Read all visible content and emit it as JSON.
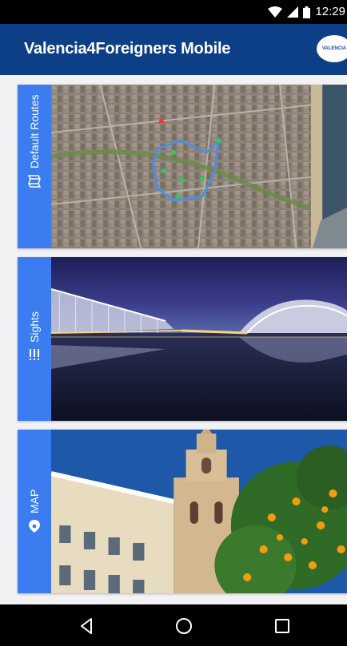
{
  "status_bar": {
    "time": "12:29"
  },
  "app_bar": {
    "title": "Valencia4Foreigners Mobile",
    "logo_text": "VALENCIA"
  },
  "cards": [
    {
      "label": "Default Routes",
      "icon": "map-fold-icon",
      "image": "city-map-route"
    },
    {
      "label": "Sights",
      "icon": "list-icon",
      "image": "city-of-arts-night"
    },
    {
      "label": "MAP",
      "icon": "location-pin-icon",
      "image": "miguelete-tower"
    }
  ],
  "nav_bar": {
    "buttons": [
      "back",
      "home",
      "recents"
    ]
  },
  "colors": {
    "app_bar": "#0d3f86",
    "tab": "#3b7cf0",
    "status_bar": "#000000"
  }
}
